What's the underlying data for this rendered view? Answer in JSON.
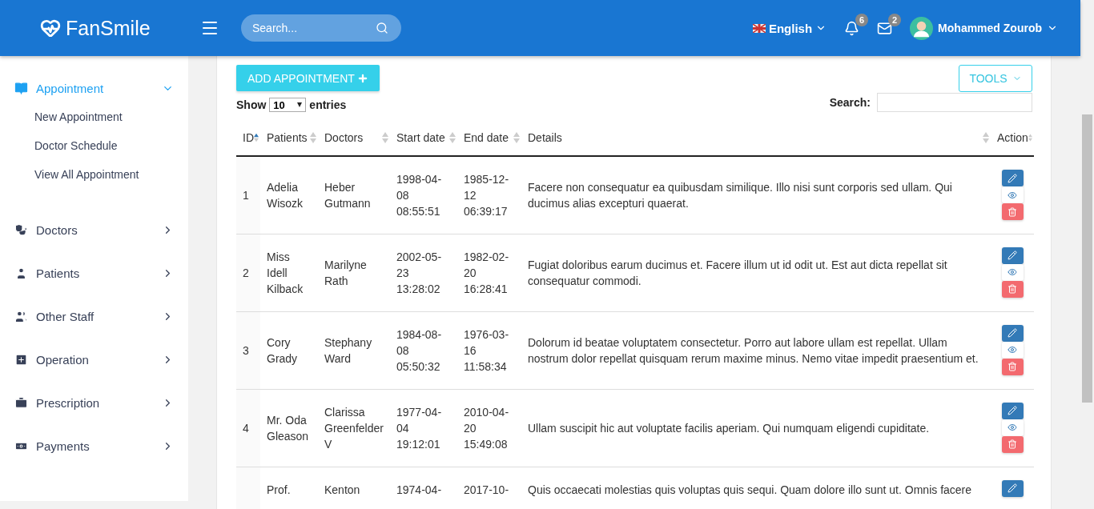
{
  "header": {
    "brand": "FanSmile",
    "search": {
      "placeholder": "Search..."
    },
    "language": "English",
    "notifications": "6",
    "messages": "2",
    "user": "Mohammed Zourob"
  },
  "sidebar": {
    "items": [
      {
        "label": "Appointment",
        "selected": true,
        "expanded": true,
        "children": [
          {
            "label": "New Appointment"
          },
          {
            "label": "Doctor Schedule"
          },
          {
            "label": "View All Appointment"
          }
        ]
      },
      {
        "label": "Doctors",
        "selected": false,
        "expanded": false
      },
      {
        "label": "Patients",
        "selected": false,
        "expanded": false
      },
      {
        "label": "Other Staff",
        "selected": false,
        "expanded": false
      },
      {
        "label": "Operation",
        "selected": false,
        "expanded": false
      },
      {
        "label": "Prescription",
        "selected": false,
        "expanded": false
      },
      {
        "label": "Payments",
        "selected": false,
        "expanded": false
      }
    ]
  },
  "toolbar": {
    "add_button": "ADD APPOINTMENT",
    "tools_button": "TOOLS",
    "show_label": "Show",
    "page_size": "10",
    "entries_label": "entries",
    "search_label": "Search:"
  },
  "table": {
    "columns": [
      {
        "label": "ID",
        "sorted": true
      },
      {
        "label": "Patients",
        "sorted": false
      },
      {
        "label": "Doctors",
        "sorted": false
      },
      {
        "label": "Start date",
        "sorted": false
      },
      {
        "label": "End date",
        "sorted": false
      },
      {
        "label": "Details",
        "sorted": false
      },
      {
        "label": "Action",
        "sorted": false
      }
    ],
    "rows": [
      {
        "id": "1",
        "patient": "Adelia Wisozk",
        "doctor": "Heber Gutmann",
        "start": "1998-04-08 08:55:51",
        "end": "1985-12-12 06:39:17",
        "details": "Facere non consequatur ea quibusdam similique. Illo nisi sunt corporis sed ullam. Qui ducimus alias excepturi quaerat."
      },
      {
        "id": "2",
        "patient": "Miss Idell Kilback",
        "doctor": "Marilyne Rath",
        "start": "2002-05-23 13:28:02",
        "end": "1982-02-20 16:28:41",
        "details": "Fugiat doloribus earum ducimus et. Facere illum ut id odit ut. Est aut dicta repellat sit consequatur commodi."
      },
      {
        "id": "3",
        "patient": "Cory Grady",
        "doctor": "Stephany Ward",
        "start": "1984-08-08 05:50:32",
        "end": "1976-03-16 11:58:34",
        "details": "Dolorum id beatae voluptatem consectetur. Porro aut labore ullam est repellat. Ullam nostrum dolor repellat quisquam rerum maxime minus. Nemo vitae impedit praesentium et."
      },
      {
        "id": "4",
        "patient": "Mr. Oda Gleason",
        "doctor": "Clarissa Greenfelder V",
        "start": "1977-04-04 19:12:01",
        "end": "2010-04-20 15:49:08",
        "details": "Ullam suscipit hic aut voluptate facilis aperiam. Qui numquam eligendi cupiditate."
      },
      {
        "patient": "Prof.",
        "doctor": "Kenton",
        "start": "1974-04-",
        "end": "2017-10-",
        "details": "Quis occaecati molestias quis voluptas quis sequi. Quam dolore illo sunt ut. Omnis facere"
      }
    ]
  }
}
